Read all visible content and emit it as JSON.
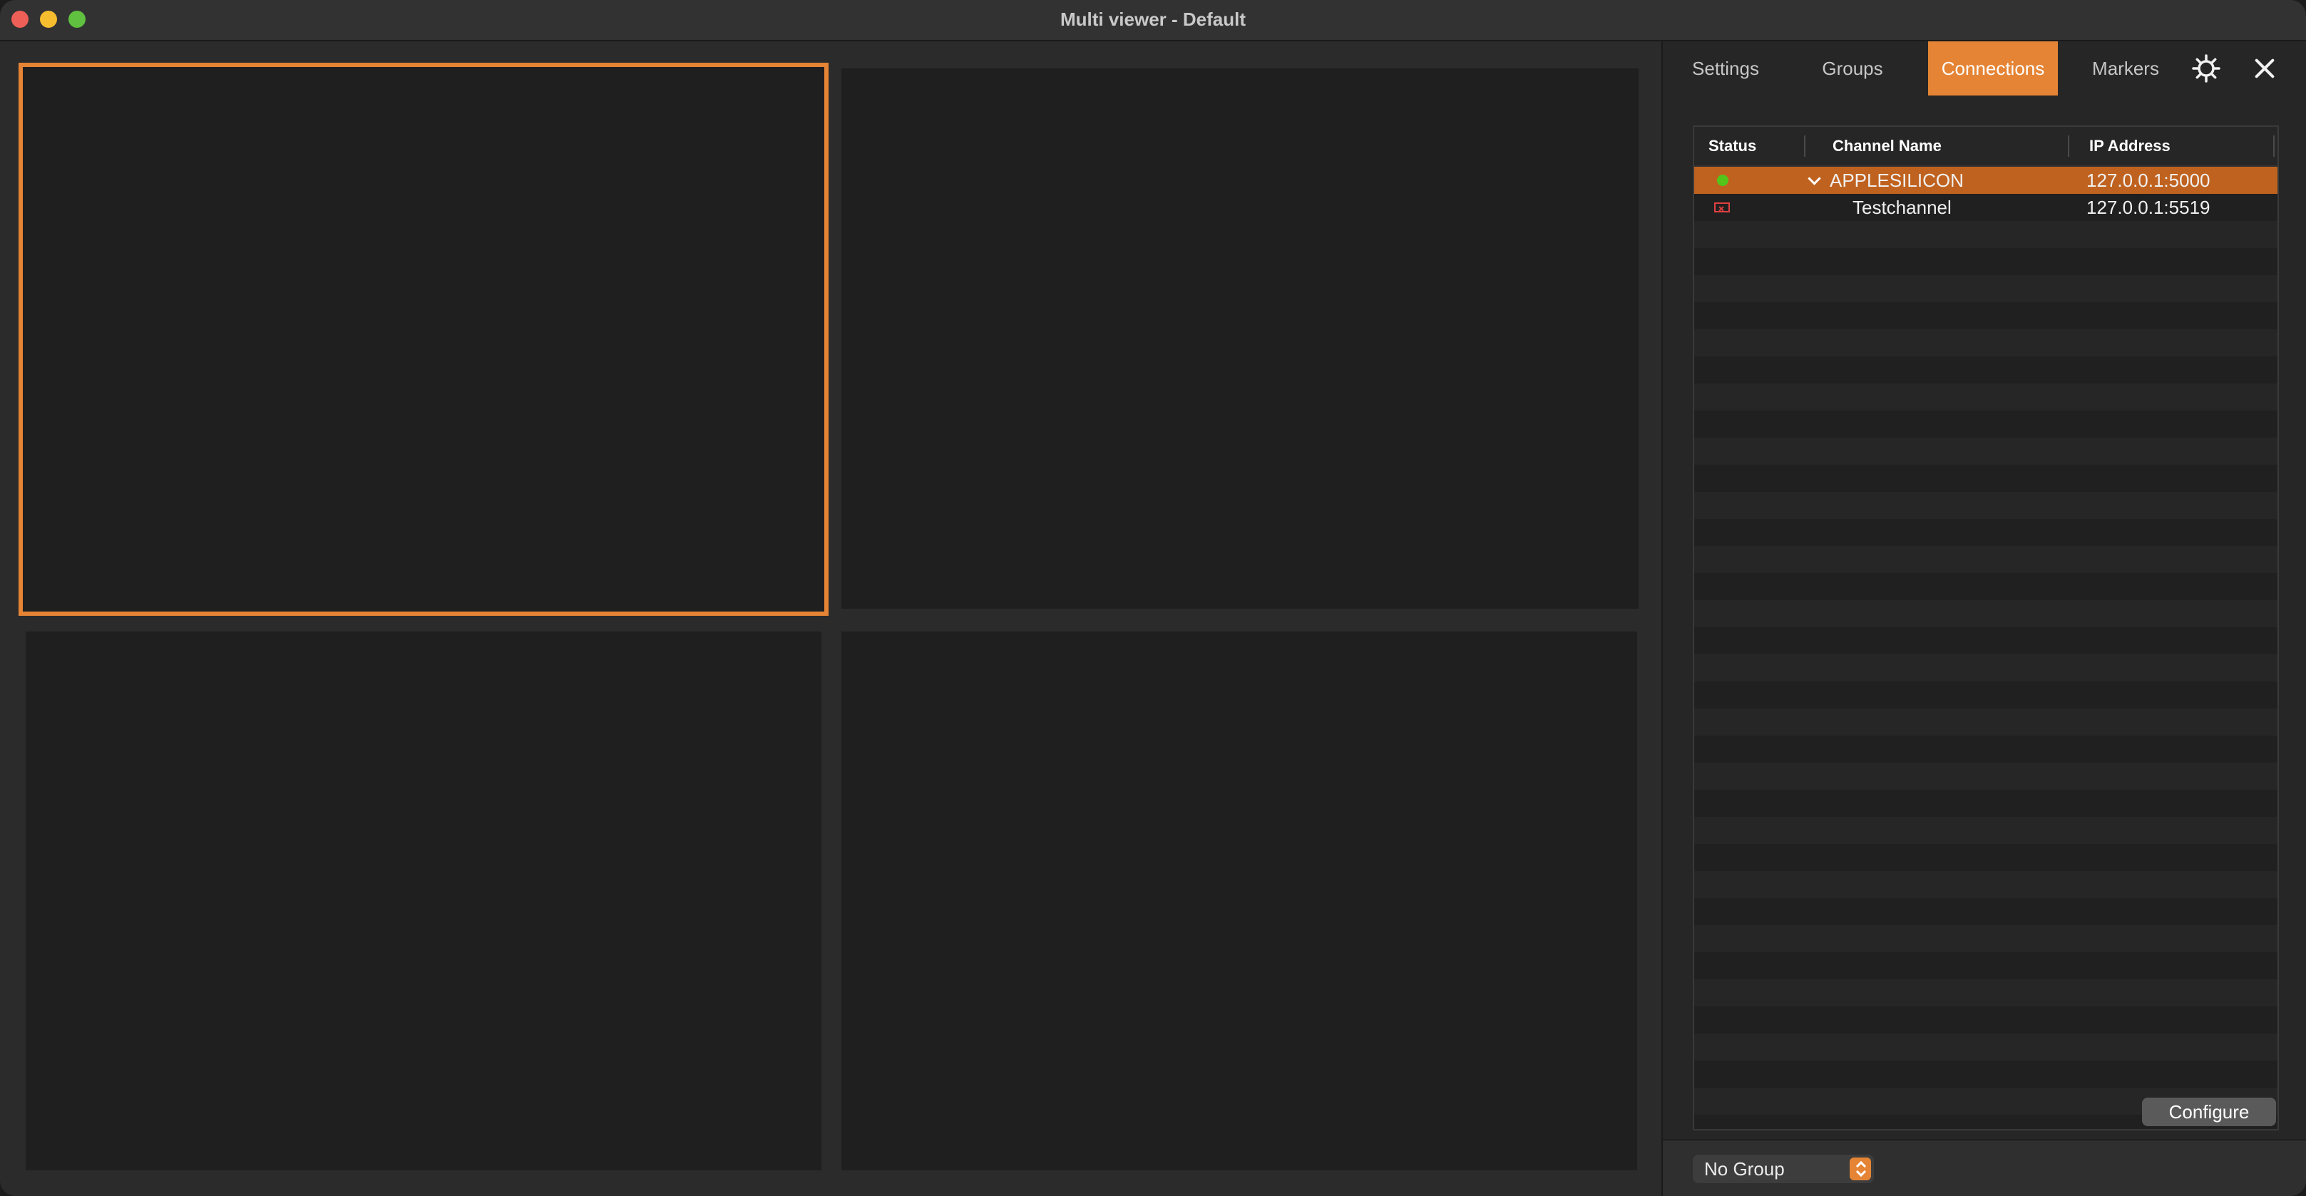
{
  "window": {
    "title": "Multi viewer - Default"
  },
  "viewer": {
    "tiles": [
      "tile-1",
      "tile-2",
      "tile-3",
      "tile-4"
    ],
    "selected_tile": 1
  },
  "panel": {
    "tabs": [
      {
        "label": "Settings"
      },
      {
        "label": "Groups"
      },
      {
        "label": "Connections"
      },
      {
        "label": "Markers"
      }
    ],
    "active_tab": "Connections",
    "icons": {
      "settings": "gear-icon",
      "close": "close-icon"
    }
  },
  "table": {
    "headers": {
      "status": "Status",
      "channel_name": "Channel Name",
      "ip_address": "IP Address"
    },
    "rows": [
      {
        "status": "connected",
        "channel_name": "APPLESILICON",
        "ip_address": "127.0.0.1:5000",
        "expanded": true
      },
      {
        "status": "error",
        "channel_name": "Testchannel",
        "ip_address": "127.0.0.1:5519"
      }
    ]
  },
  "buttons": {
    "configure": "Configure"
  },
  "group_select": {
    "value": "No Group"
  },
  "colors": {
    "accent": "#e58434",
    "selected_row": "#c0621f",
    "status_ok": "#52c41a",
    "status_error": "#e04040"
  }
}
